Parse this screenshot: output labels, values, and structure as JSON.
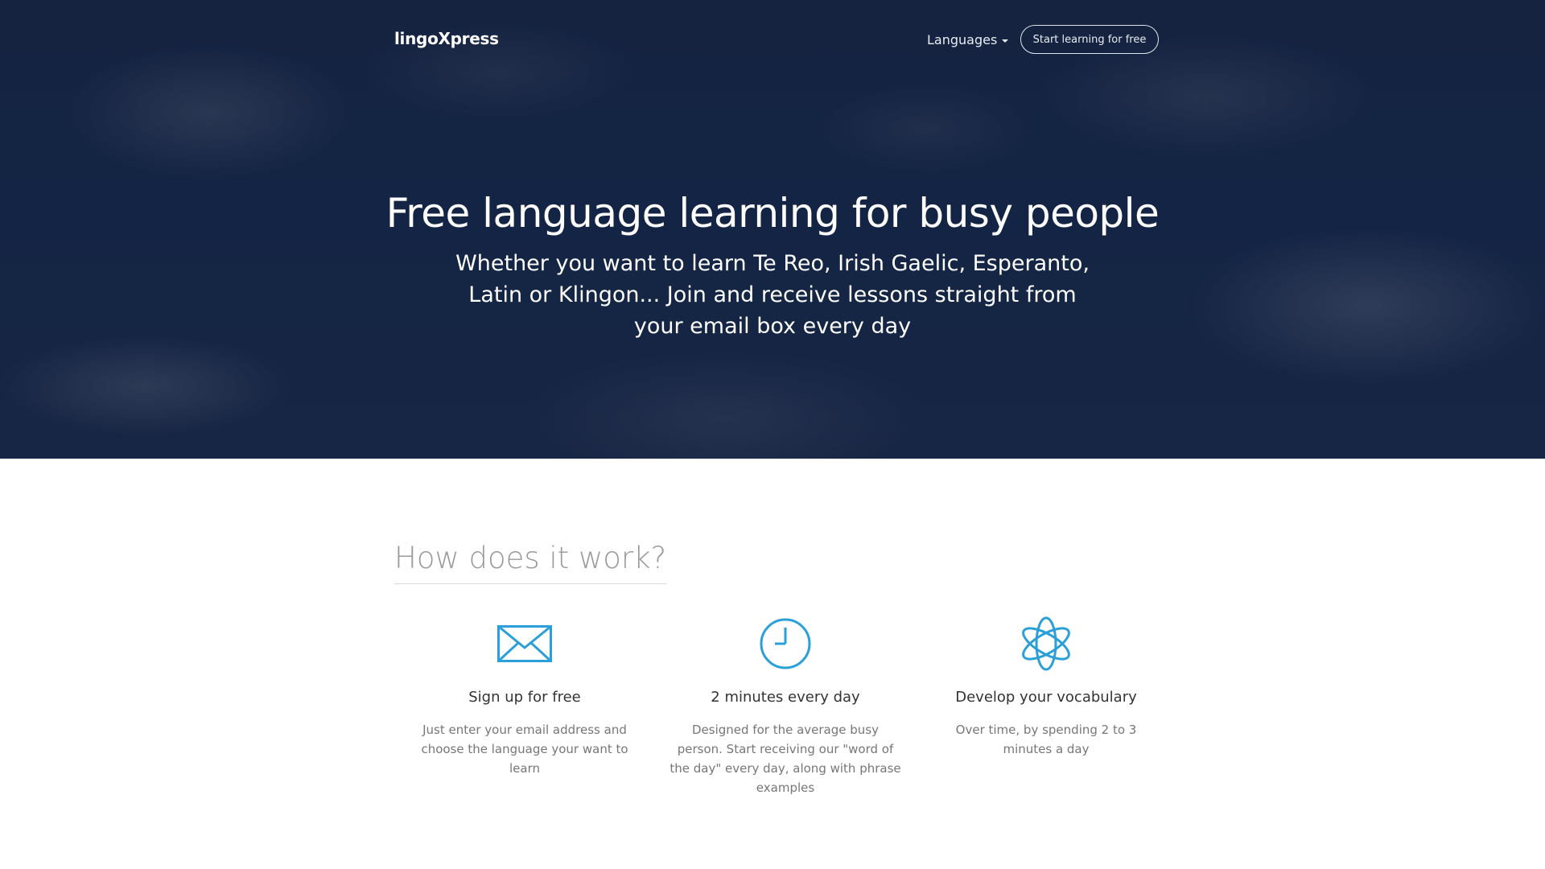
{
  "nav": {
    "brand": "lingoXpress",
    "languages_label": "Languages",
    "cta_label": "Start learning for free"
  },
  "hero": {
    "title": "Free language learning for busy people",
    "subtitle": "Whether you want to learn Te Reo, Irish Gaelic, Esperanto, Latin or Klingon... Join and receive lessons straight from your email box every day"
  },
  "how": {
    "title": "How does it work?",
    "features": [
      {
        "icon": "envelope-icon",
        "title": "Sign up for free",
        "desc": "Just enter your email address and choose the language your want to learn"
      },
      {
        "icon": "clock-icon",
        "title": "2 minutes every day",
        "desc": "Designed for the average busy person. Start receiving our \"word of the day\" every day, along with phrase examples"
      },
      {
        "icon": "atom-icon",
        "title": "Develop your vocabulary",
        "desc": "Over time, by spending 2 to 3 minutes a day"
      }
    ]
  },
  "colors": {
    "accent": "#2a9fd8",
    "hero_overlay": "#1b2d4f"
  }
}
